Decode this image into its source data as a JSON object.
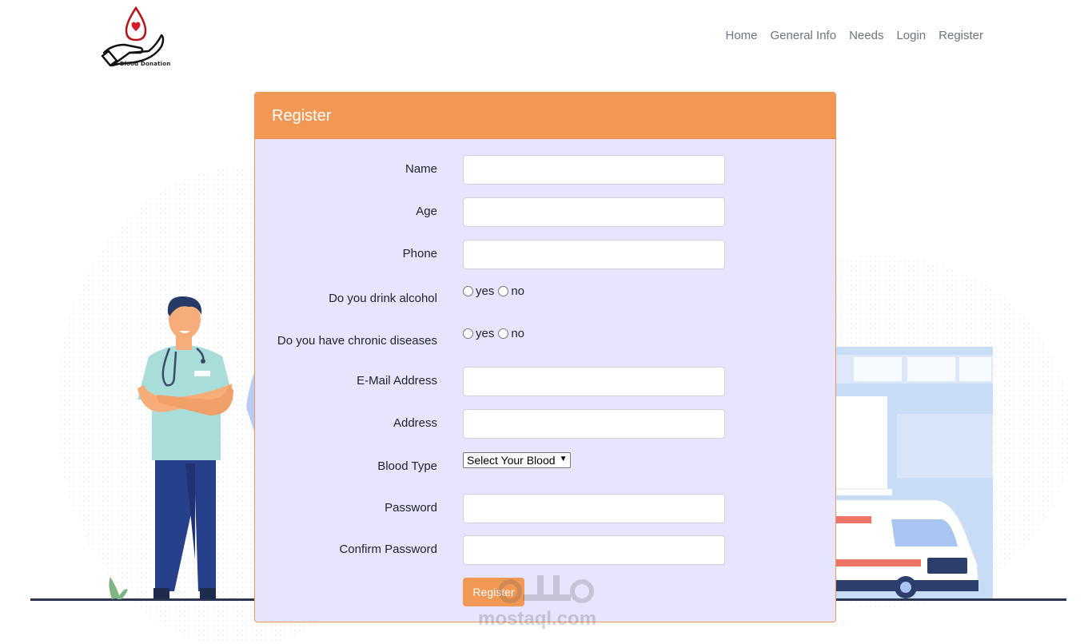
{
  "brand": {
    "logo_text": "Blood Donation",
    "logo_icon": "blood-drop-hand-icon"
  },
  "nav": {
    "items": [
      {
        "label": "Home"
      },
      {
        "label": "General Info"
      },
      {
        "label": "Needs"
      },
      {
        "label": "Login"
      },
      {
        "label": "Register"
      }
    ]
  },
  "form": {
    "title": "Register",
    "fields": {
      "name": {
        "label": "Name",
        "value": ""
      },
      "age": {
        "label": "Age",
        "value": ""
      },
      "phone": {
        "label": "Phone",
        "value": ""
      },
      "alcohol": {
        "label": "Do you drink alcohol",
        "yes": "yes",
        "no": "no"
      },
      "chronic": {
        "label": "Do you have chronic diseases",
        "yes": "yes",
        "no": "no"
      },
      "email": {
        "label": "E-Mail Address",
        "value": ""
      },
      "address": {
        "label": "Address",
        "value": ""
      },
      "blood_type": {
        "label": "Blood Type",
        "selected": "Select Your Blood"
      },
      "password": {
        "label": "Password",
        "value": ""
      },
      "confirm_password": {
        "label": "Confirm Password",
        "value": ""
      }
    },
    "submit_label": "Register"
  },
  "watermark": {
    "text": "mostaql.com"
  },
  "colors": {
    "accent": "#f19855",
    "card_bg": "#e6e5fd",
    "nav_text": "#6c757d"
  }
}
